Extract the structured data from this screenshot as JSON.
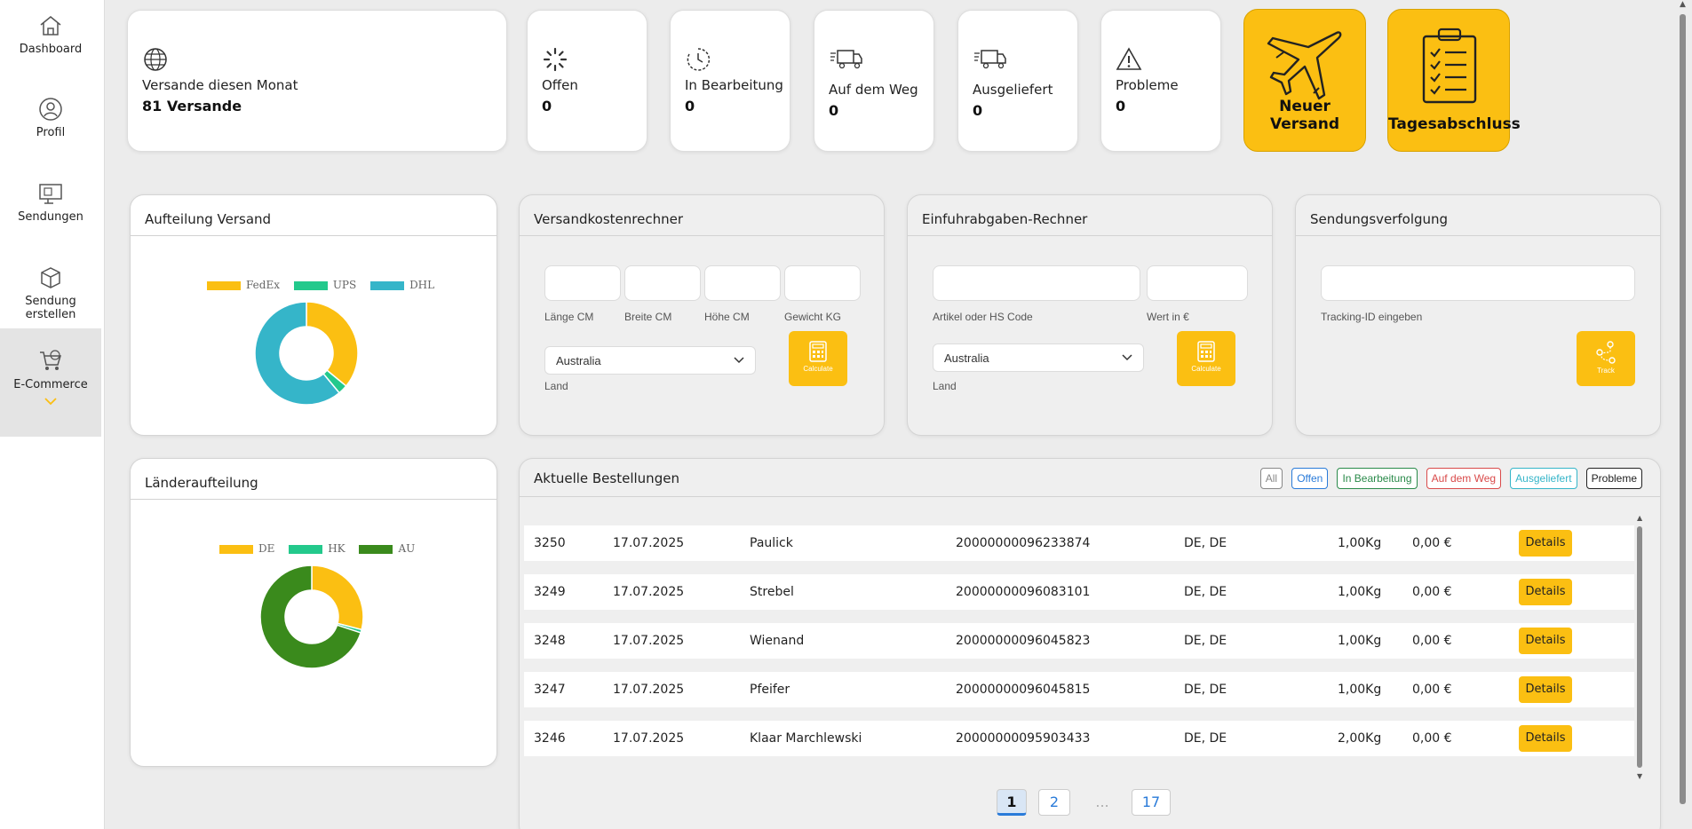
{
  "sidebar": {
    "items": [
      {
        "label": "Dashboard",
        "icon": "dashboard-icon"
      },
      {
        "label": "Profil",
        "icon": "profile-icon"
      },
      {
        "label": "Sendungen",
        "icon": "shipments-icon"
      },
      {
        "label": "Sendung erstellen",
        "icon": "create-shipment-icon"
      },
      {
        "label": "E-Commerce",
        "icon": "ecommerce-cart-icon"
      }
    ]
  },
  "stats": {
    "month": {
      "label": "Versande diesen Monat",
      "value": "81 Versande"
    },
    "open": {
      "label": "Offen",
      "value": "0"
    },
    "processing": {
      "label": "In Bearbeitung",
      "value": "0"
    },
    "on_way": {
      "label": "Auf dem Weg",
      "value": "0"
    },
    "delivered": {
      "label": "Ausgeliefert",
      "value": "0"
    },
    "problems": {
      "label": "Probleme",
      "value": "0"
    }
  },
  "actions": {
    "new_shipment": "Neuer Versand",
    "day_end": "Tagesabschluss"
  },
  "panels": {
    "carrier_split": {
      "title": "Aufteilung Versand"
    },
    "country_split": {
      "title": "Länderaufteilung"
    },
    "cost_calc": {
      "title": "Versandkostenrechner",
      "length": "Länge CM",
      "width": "Breite CM",
      "height": "Höhe CM",
      "weight": "Gewicht KG",
      "country": "Australia",
      "country_label": "Land",
      "button": "Calculate"
    },
    "import_calc": {
      "title": "Einfuhrabgaben-Rechner",
      "article": "Artikel oder HS Code",
      "value": "Wert in €",
      "country": "Australia",
      "country_label": "Land",
      "button": "Calculate"
    },
    "tracking": {
      "title": "Sendungsverfolgung",
      "input_label": "Tracking-ID eingeben",
      "button": "Track"
    }
  },
  "chart_data": [
    {
      "type": "pie",
      "labels": [
        "FedEx",
        "UPS",
        "DHL"
      ],
      "values": [
        36,
        3,
        61
      ],
      "colors": [
        "#fbbf12",
        "#23c98c",
        "#35b5c9"
      ]
    },
    {
      "type": "pie",
      "labels": [
        "DE",
        "HK",
        "AU"
      ],
      "values": [
        29,
        1,
        70
      ],
      "colors": [
        "#fbbf12",
        "#23c98c",
        "#3a8a1c"
      ]
    }
  ],
  "orders": {
    "title": "Aktuelle Bestellungen",
    "filters": [
      {
        "label": "All",
        "color": "#888888"
      },
      {
        "label": "Offen",
        "color": "#2a7bd9"
      },
      {
        "label": "In Bearbeitung",
        "color": "#2a8a4a"
      },
      {
        "label": "Auf dem Weg",
        "color": "#d94a4a"
      },
      {
        "label": "Ausgeliefert",
        "color": "#35b5c9"
      },
      {
        "label": "Probleme",
        "color": "#222222"
      }
    ],
    "details_label": "Details",
    "rows": [
      {
        "id": "3250",
        "date": "17.07.2025",
        "name": "Paulick",
        "tracking": "20000000096233874",
        "country": "DE, DE",
        "weight": "1,00Kg",
        "price": "0,00 €"
      },
      {
        "id": "3249",
        "date": "17.07.2025",
        "name": "Strebel",
        "tracking": "20000000096083101",
        "country": "DE, DE",
        "weight": "1,00Kg",
        "price": "0,00 €"
      },
      {
        "id": "3248",
        "date": "17.07.2025",
        "name": "Wienand",
        "tracking": "20000000096045823",
        "country": "DE, DE",
        "weight": "1,00Kg",
        "price": "0,00 €"
      },
      {
        "id": "3247",
        "date": "17.07.2025",
        "name": "Pfeifer",
        "tracking": "20000000096045815",
        "country": "DE, DE",
        "weight": "1,00Kg",
        "price": "0,00 €"
      },
      {
        "id": "3246",
        "date": "17.07.2025",
        "name": "Klaar Marchlewski",
        "tracking": "20000000095903433",
        "country": "DE, DE",
        "weight": "2,00Kg",
        "price": "0,00 €"
      }
    ],
    "pagination": [
      "1",
      "2",
      "...",
      "17"
    ]
  }
}
